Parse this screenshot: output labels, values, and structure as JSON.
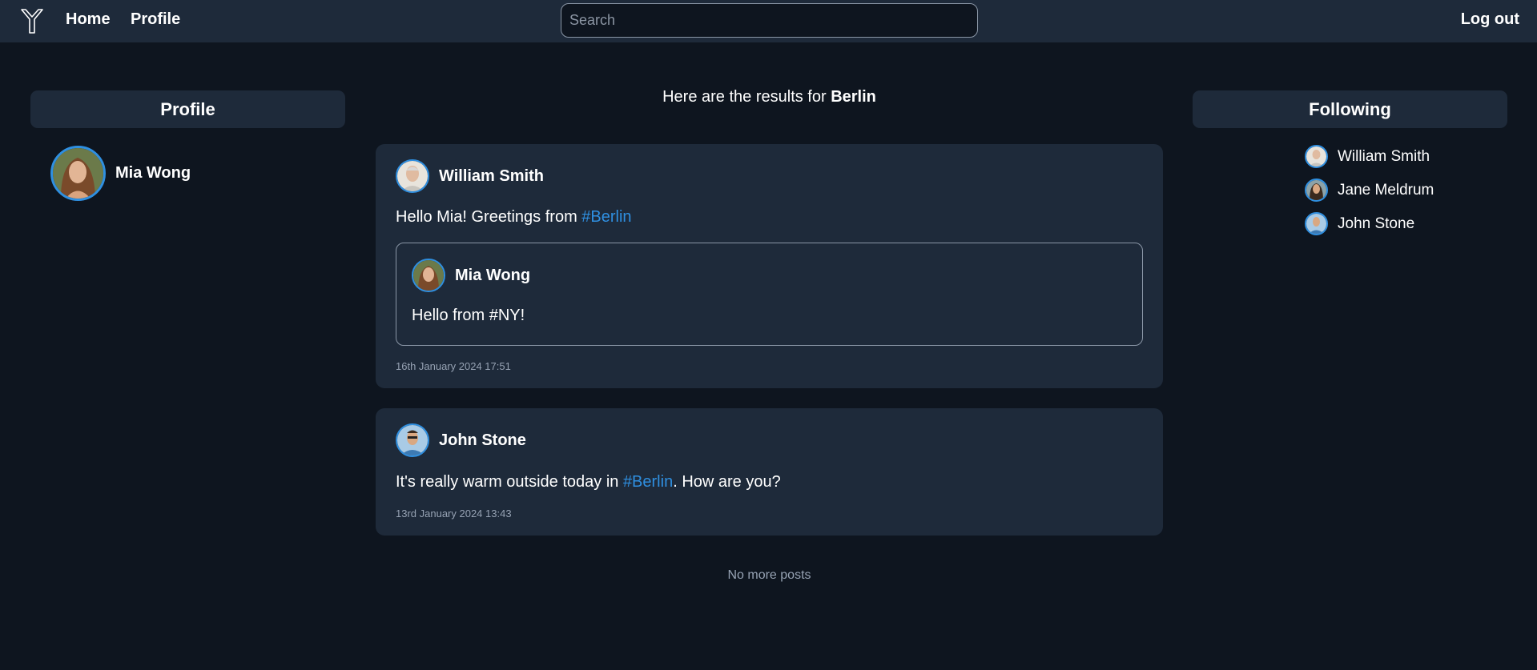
{
  "nav": {
    "home_label": "Home",
    "profile_label": "Profile",
    "logout_label": "Log out",
    "search_placeholder": "Search",
    "search_value": ""
  },
  "left_panel": {
    "header": "Profile",
    "user_name": "Mia Wong"
  },
  "results": {
    "prefix": "Here are the results for ",
    "query": "Berlin"
  },
  "posts": [
    {
      "author": "William Smith",
      "text_before": "Hello Mia! Greetings from ",
      "hashtag": "#Berlin",
      "text_after": "",
      "quoted": {
        "author": "Mia Wong",
        "text": "Hello from #NY!"
      },
      "timestamp": "16th January 2024 17:51"
    },
    {
      "author": "John Stone",
      "text_before": "It's really warm outside today in ",
      "hashtag": "#Berlin",
      "text_after": ". How are you?",
      "timestamp": "13rd January 2024 13:43"
    }
  ],
  "no_more": "No more posts",
  "right_panel": {
    "header": "Following",
    "items": [
      {
        "name": "William Smith"
      },
      {
        "name": "Jane Meldrum"
      },
      {
        "name": "John Stone"
      }
    ]
  },
  "colors": {
    "background": "#0e151f",
    "panel": "#1e2a3a",
    "accent": "#2f8fe0",
    "muted_text": "#96a2b3"
  }
}
